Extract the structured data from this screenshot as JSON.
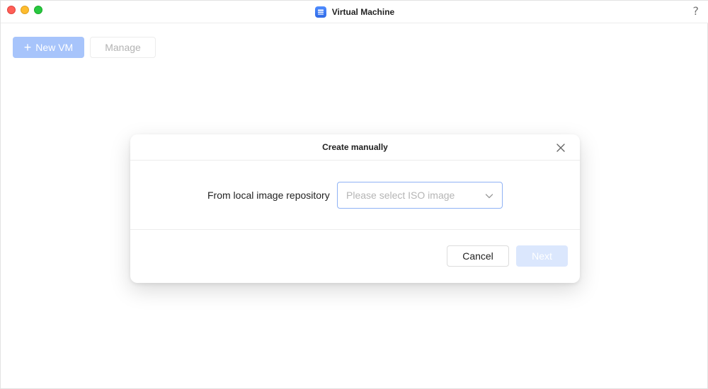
{
  "window": {
    "title": "Virtual Machine",
    "help_label": "?"
  },
  "toolbar": {
    "new_vm_label": "New VM",
    "new_vm_icon": "plus-icon",
    "manage_label": "Manage"
  },
  "modal": {
    "title": "Create manually",
    "field_label": "From local image repository",
    "select_placeholder": "Please select ISO image",
    "cancel_label": "Cancel",
    "next_label": "Next"
  },
  "colors": {
    "accent": "#4f8cff",
    "primary_disabled": "#a7c4fb",
    "next_disabled": "#dbe7fd",
    "select_border": "#8fb2f5"
  },
  "icons": {
    "app": "virtual-machine-app-icon",
    "close": "close-icon",
    "chevron": "chevron-down-icon",
    "help": "help-icon"
  }
}
